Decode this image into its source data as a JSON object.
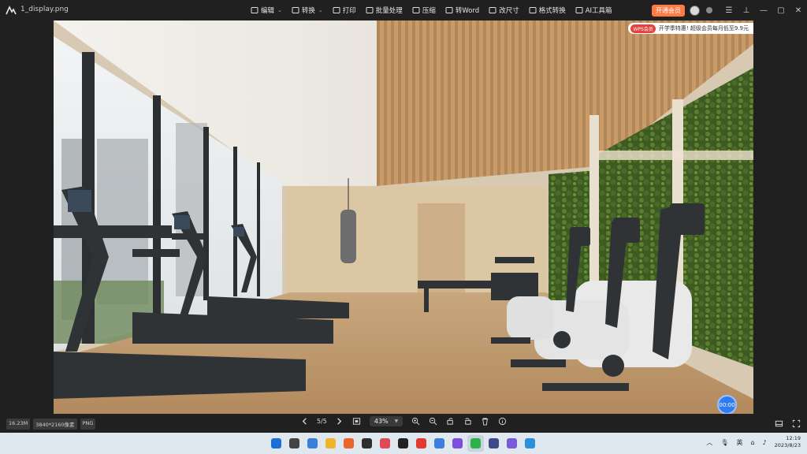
{
  "window": {
    "file_name": "1_display.png"
  },
  "toolbar": {
    "items": [
      {
        "label": "编辑",
        "icon": "edit-icon",
        "caret": true
      },
      {
        "label": "转换",
        "icon": "convert-icon",
        "caret": true
      },
      {
        "label": "打印",
        "icon": "print-icon",
        "caret": false
      },
      {
        "label": "批量处理",
        "icon": "batch-icon",
        "caret": false
      },
      {
        "label": "压缩",
        "icon": "compress-icon",
        "caret": false
      },
      {
        "label": "转Word",
        "icon": "word-icon",
        "caret": false
      },
      {
        "label": "改尺寸",
        "icon": "resize-icon",
        "caret": false
      },
      {
        "label": "格式转换",
        "icon": "format-icon",
        "caret": false
      },
      {
        "label": "AI工具箱",
        "icon": "ai-icon",
        "caret": false
      }
    ]
  },
  "header_right": {
    "vip_label": "开通会员"
  },
  "promo": {
    "tag": "WPS会员",
    "text": "开学季特惠! 超级会员每月低至9.9元"
  },
  "status": {
    "file_size": "16.23M",
    "resolution": "3840*2160像素",
    "format": "PNG"
  },
  "navigation": {
    "page": "5/5",
    "zoom": "43%"
  },
  "timer": {
    "label": "00:00"
  },
  "taskbar": {
    "time": "12:19",
    "date": "2023/8/23",
    "input_method": "英",
    "apps": [
      {
        "name": "start",
        "color": "#1b6fd6"
      },
      {
        "name": "task-view",
        "color": "#444"
      },
      {
        "name": "widgets",
        "color": "#3c7fd9"
      },
      {
        "name": "file-explorer",
        "color": "#f0b429"
      },
      {
        "name": "firefox",
        "color": "#e8662b"
      },
      {
        "name": "terminal",
        "color": "#2e2e2e"
      },
      {
        "name": "app-red",
        "color": "#e04a55"
      },
      {
        "name": "app-dark",
        "color": "#222"
      },
      {
        "name": "wps",
        "color": "#e23b2e"
      },
      {
        "name": "app-blue",
        "color": "#3a7ee0"
      },
      {
        "name": "app-purple",
        "color": "#7b4ee0"
      },
      {
        "name": "wechat",
        "color": "#2bb24c"
      },
      {
        "name": "app-gradient",
        "color": "#3c4a8c"
      },
      {
        "name": "wps-image",
        "color": "#7a5ad6"
      },
      {
        "name": "app-cyan",
        "color": "#2b90d9"
      }
    ]
  }
}
